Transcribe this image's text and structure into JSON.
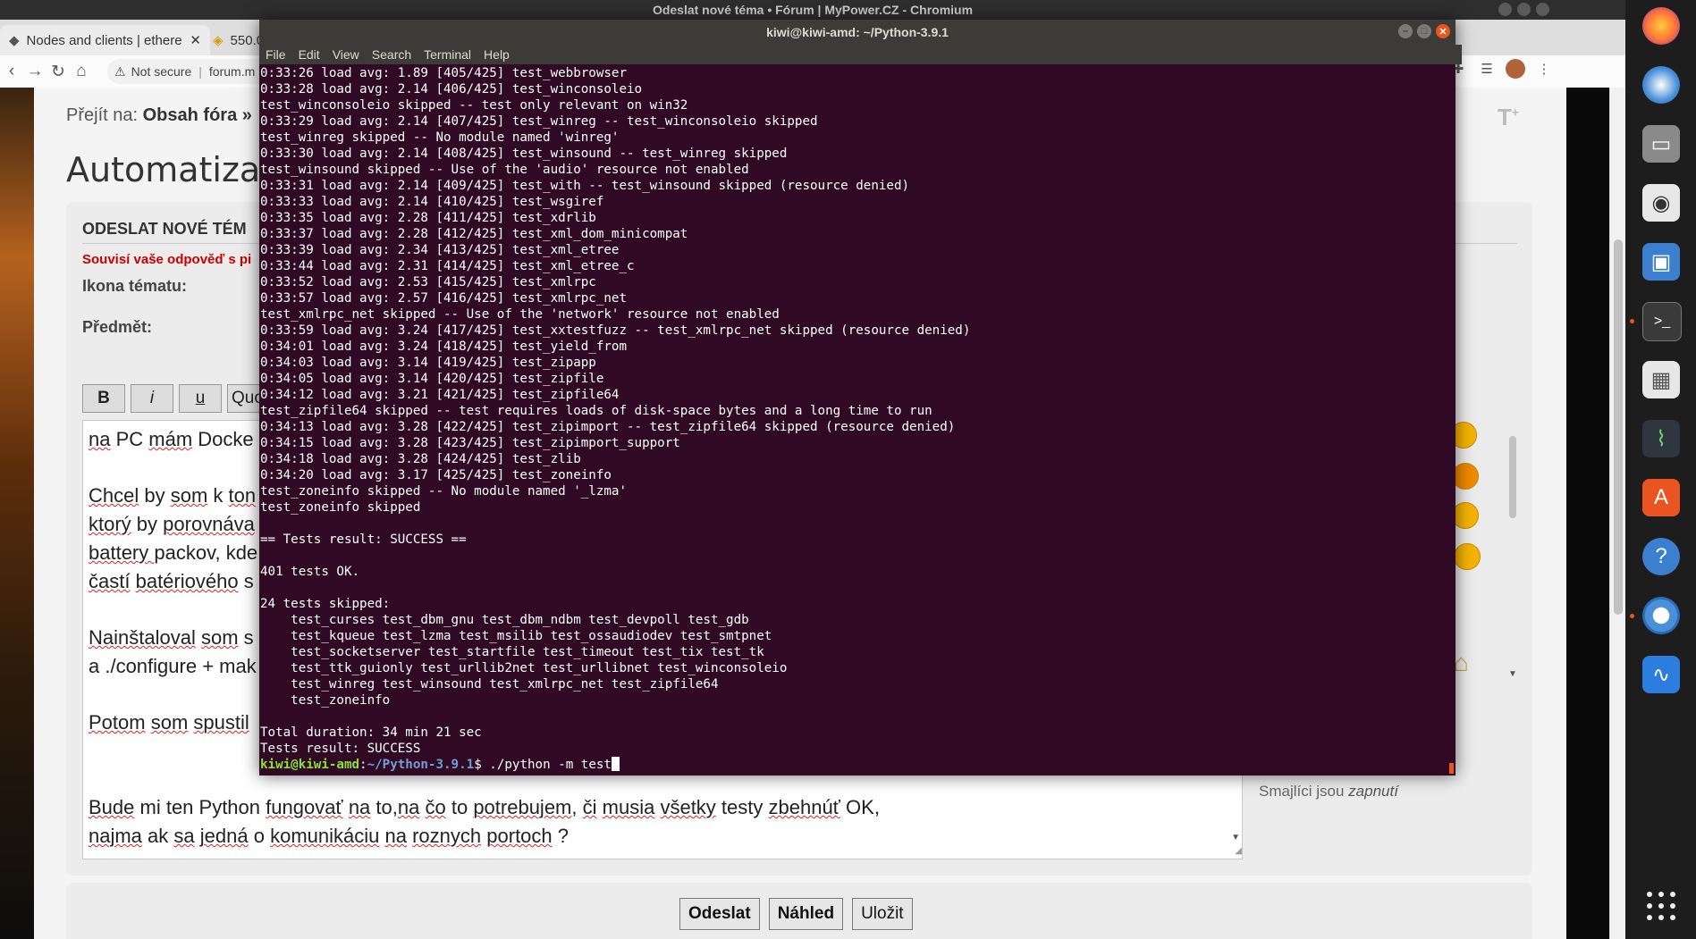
{
  "chrome": {
    "window_title": "Odeslat nové téma • Fórum | MyPower.CZ - Chromium",
    "tabs": [
      {
        "label": "Nodes and clients | ethere"
      },
      {
        "label": "550.0"
      }
    ],
    "security_label": "Not secure",
    "url": "forum.m"
  },
  "forum": {
    "breadcrumb_prefix": "Přejít na:",
    "breadcrumb_link": "Obsah fóra »",
    "topic_title": "Automatizace,",
    "panel_heading": "ODESLAT NOVÉ TÉM",
    "notice": "Souvisí vaše odpověď s pi",
    "icon_label": "Ikona tématu:",
    "subject_label": "Předmět:",
    "format_buttons": {
      "bold": "B",
      "italic": "i",
      "underline": "u",
      "quote": "Quote"
    },
    "editor_lines": [
      [
        "na",
        " PC ",
        "mám",
        " Docke"
      ],
      [
        "Chcel",
        " by ",
        "som",
        " k ",
        "ton"
      ],
      [
        "ktorý",
        " by ",
        "porovnáva"
      ],
      [
        "battery ",
        "packov",
        ", ",
        "kde"
      ],
      [
        "častí",
        " ",
        "batériového",
        " s"
      ],
      [
        "Nainštaloval",
        " ",
        "som",
        " s"
      ],
      [
        "a ./configure + mak"
      ],
      [
        "Potom",
        " ",
        "som",
        " ",
        "spustil"
      ],
      [
        "Bude",
        " mi ten Python ",
        "fungovať",
        " ",
        "na",
        " to,",
        "na",
        " ",
        "čo",
        " to ",
        "potrebujem",
        ", ",
        "či",
        " ",
        "musia",
        " ",
        "všetky",
        " testy ",
        "zbehnúť",
        " OK,"
      ],
      [
        "najma",
        " ak ",
        "sa",
        " ",
        "jedná",
        " o ",
        "komunikáciu",
        " ",
        "na",
        " ",
        "roznych",
        " ",
        "portoch",
        " ?"
      ]
    ],
    "smileys_state_prefix": "Smajlíci jsou",
    "smileys_state_value": "zapnutí",
    "buttons": {
      "submit": "Odeslat",
      "preview": "Náhled",
      "save": "Uložit"
    }
  },
  "terminal": {
    "title": "kiwi@kiwi-amd: ~/Python-3.9.1",
    "menu": [
      "File",
      "Edit",
      "View",
      "Search",
      "Terminal",
      "Help"
    ],
    "lines": [
      "0:33:26 load avg: 1.89 [405/425] test_webbrowser",
      "0:33:28 load avg: 2.14 [406/425] test_winconsoleio",
      "test_winconsoleio skipped -- test only relevant on win32",
      "0:33:29 load avg: 2.14 [407/425] test_winreg -- test_winconsoleio skipped",
      "test_winreg skipped -- No module named 'winreg'",
      "0:33:30 load avg: 2.14 [408/425] test_winsound -- test_winreg skipped",
      "test_winsound skipped -- Use of the 'audio' resource not enabled",
      "0:33:31 load avg: 2.14 [409/425] test_with -- test_winsound skipped (resource denied)",
      "0:33:33 load avg: 2.14 [410/425] test_wsgiref",
      "0:33:35 load avg: 2.28 [411/425] test_xdrlib",
      "0:33:37 load avg: 2.28 [412/425] test_xml_dom_minicompat",
      "0:33:39 load avg: 2.34 [413/425] test_xml_etree",
      "0:33:44 load avg: 2.31 [414/425] test_xml_etree_c",
      "0:33:52 load avg: 2.53 [415/425] test_xmlrpc",
      "0:33:57 load avg: 2.57 [416/425] test_xmlrpc_net",
      "test_xmlrpc_net skipped -- Use of the 'network' resource not enabled",
      "0:33:59 load avg: 3.24 [417/425] test_xxtestfuzz -- test_xmlrpc_net skipped (resource denied)",
      "0:34:01 load avg: 3.24 [418/425] test_yield_from",
      "0:34:03 load avg: 3.14 [419/425] test_zipapp",
      "0:34:05 load avg: 3.14 [420/425] test_zipfile",
      "0:34:12 load avg: 3.21 [421/425] test_zipfile64",
      "test_zipfile64 skipped -- test requires loads of disk-space bytes and a long time to run",
      "0:34:13 load avg: 3.28 [422/425] test_zipimport -- test_zipfile64 skipped (resource denied)",
      "0:34:15 load avg: 3.28 [423/425] test_zipimport_support",
      "0:34:18 load avg: 3.28 [424/425] test_zlib",
      "0:34:20 load avg: 3.17 [425/425] test_zoneinfo",
      "test_zoneinfo skipped -- No module named '_lzma'",
      "test_zoneinfo skipped",
      "",
      "== Tests result: SUCCESS ==",
      "",
      "401 tests OK.",
      "",
      "24 tests skipped:",
      "    test_curses test_dbm_gnu test_dbm_ndbm test_devpoll test_gdb",
      "    test_kqueue test_lzma test_msilib test_ossaudiodev test_smtpnet",
      "    test_socketserver test_startfile test_timeout test_tix test_tk",
      "    test_ttk_guionly test_urllib2net test_urllibnet test_winconsoleio",
      "    test_winreg test_winsound test_xmlrpc_net test_zipfile64",
      "    test_zoneinfo",
      "",
      "Total duration: 34 min 21 sec",
      "Tests result: SUCCESS"
    ],
    "prompt_user": "kiwi@kiwi-amd",
    "prompt_sep": ":",
    "prompt_path": "~/Python-3.9.1",
    "prompt_symbol": "$ ",
    "command": "./python -m test"
  },
  "dock": {
    "apps": [
      "firefox-icon",
      "thunderbird-icon",
      "files-icon",
      "rhythmbox-icon",
      "image-viewer-icon",
      "terminal-icon",
      "calculator-icon",
      "system-monitor-icon",
      "software-center-icon",
      "help-icon",
      "chromium-icon",
      "waveform-icon"
    ]
  }
}
